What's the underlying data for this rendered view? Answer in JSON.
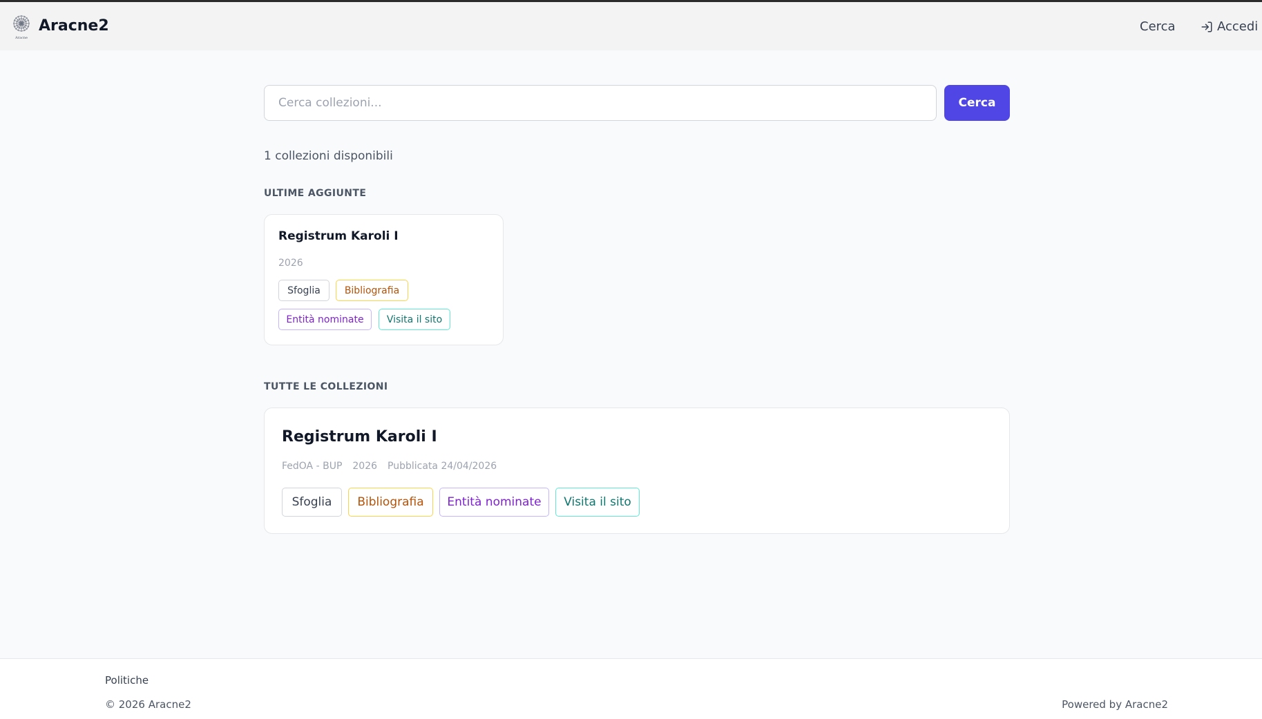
{
  "header": {
    "brand": "Aracne2",
    "logo_caption": "Aracne",
    "nav_search": "Cerca",
    "nav_login": "Accedi"
  },
  "search": {
    "placeholder": "Cerca collezioni...",
    "value": "",
    "button_label": "Cerca"
  },
  "summary": {
    "count_text": "1 collezioni disponibili"
  },
  "latest": {
    "heading": "ULTIME AGGIUNTE",
    "items": [
      {
        "title": "Registrum Karoli I",
        "year": "2026",
        "actions": [
          "Sfoglia",
          "Bibliografia",
          "Entità nominate",
          "Visita il sito"
        ]
      }
    ]
  },
  "all": {
    "heading": "TUTTE LE COLLEZIONI",
    "items": [
      {
        "title": "Registrum Karoli I",
        "publisher": "FedOA - BUP",
        "year": "2026",
        "published": "Pubblicata 24/04/2026",
        "actions": [
          "Sfoglia",
          "Bibliografia",
          "Entità nominate",
          "Visita il sito"
        ]
      }
    ]
  },
  "footer": {
    "policies": "Politiche",
    "copyright": "© 2026 Aracne2",
    "powered": "Powered by Aracne2"
  },
  "colors": {
    "accent": "#4f46e5",
    "tag_browse": "#374151",
    "tag_bibliography": "#b45309",
    "tag_entities": "#7e22ce",
    "tag_site": "#0f766e"
  },
  "icons": {
    "logo": "aracne-logo-icon",
    "login": "login-icon"
  }
}
